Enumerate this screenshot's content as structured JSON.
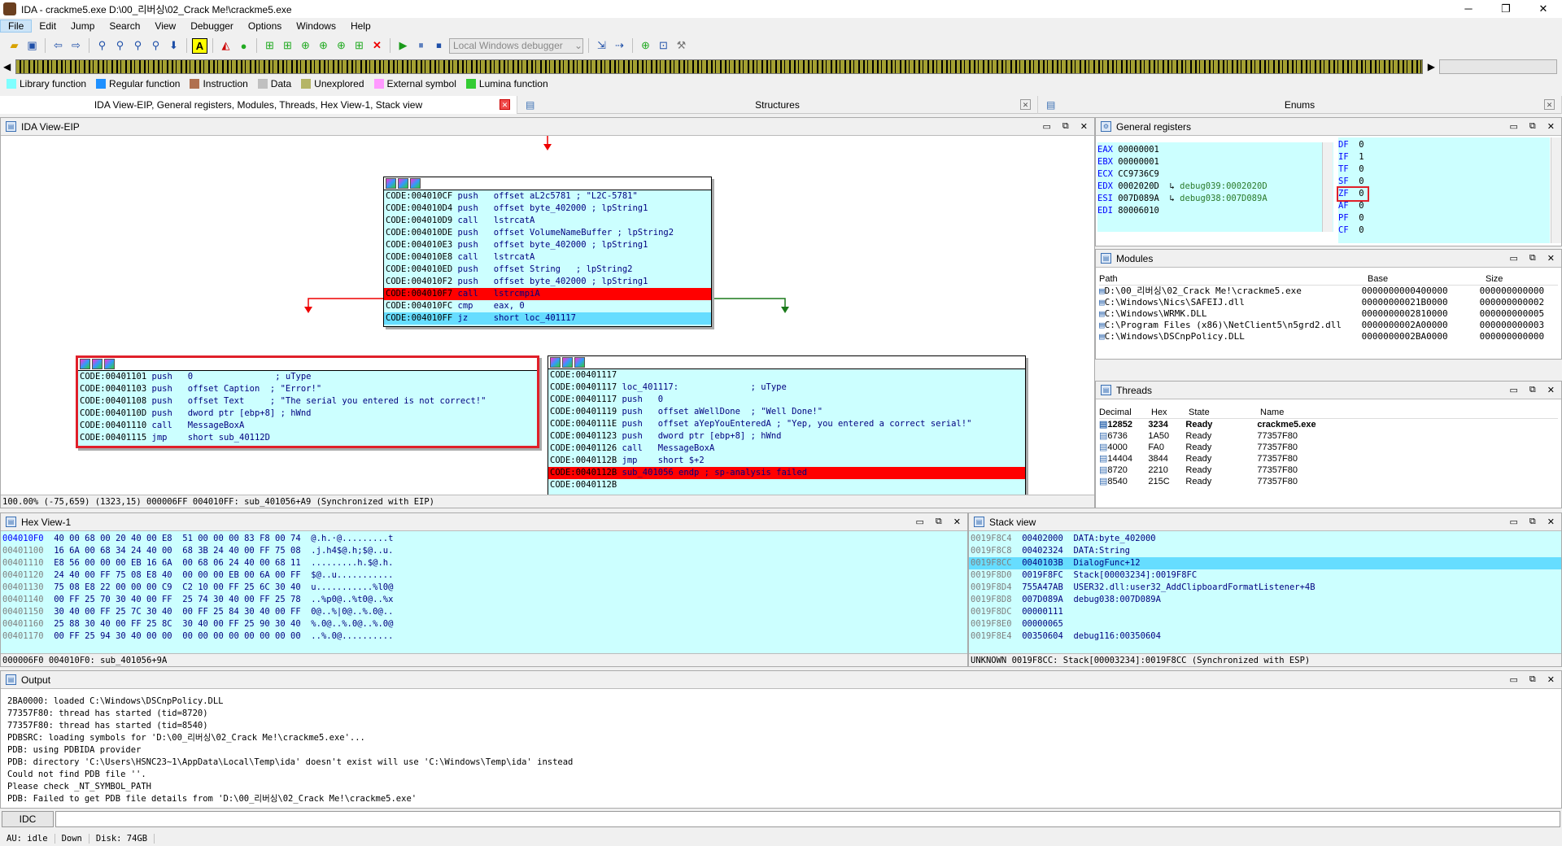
{
  "window": {
    "title": "IDA - crackme5.exe D:\\00_리버싱\\02_Crack Me!\\crackme5.exe",
    "minimize": "─",
    "maximize": "❐",
    "close": "✕"
  },
  "menu": [
    "File",
    "Edit",
    "Jump",
    "Search",
    "View",
    "Debugger",
    "Options",
    "Windows",
    "Help"
  ],
  "toolbar": {
    "debugger_select": "Local Windows debugger"
  },
  "legend": [
    {
      "label": "Library function",
      "color": "#7fffff"
    },
    {
      "label": "Regular function",
      "color": "#1e90ff"
    },
    {
      "label": "Instruction",
      "color": "#b07050"
    },
    {
      "label": "Data",
      "color": "#c0c0c0"
    },
    {
      "label": "Unexplored",
      "color": "#b5b566"
    },
    {
      "label": "External symbol",
      "color": "#ff99ff"
    },
    {
      "label": "Lumina function",
      "color": "#33cc33"
    }
  ],
  "tabs": [
    {
      "label": "IDA View-EIP, General registers, Modules, Threads, Hex View-1, Stack view"
    },
    {
      "label": "Structures"
    },
    {
      "label": "Enums"
    }
  ],
  "ida_view": {
    "title": "IDA View-EIP",
    "status": "100.00% (-75,659) (1323,15) 000006FF 004010FF: sub_401056+A9 (Synchronized with EIP)",
    "top_block": [
      {
        "a": "CODE:004010CF",
        "m": "push",
        "o": "offset aL2c5781 ; \"L2C-5781\"",
        "h": ""
      },
      {
        "a": "CODE:004010D4",
        "m": "push",
        "o": "offset byte_402000 ; lpString1",
        "h": ""
      },
      {
        "a": "CODE:004010D9",
        "m": "call",
        "o": "lstrcatA",
        "h": ""
      },
      {
        "a": "CODE:004010DE",
        "m": "push",
        "o": "offset VolumeNameBuffer ; lpString2",
        "h": ""
      },
      {
        "a": "CODE:004010E3",
        "m": "push",
        "o": "offset byte_402000 ; lpString1",
        "h": ""
      },
      {
        "a": "CODE:004010E8",
        "m": "call",
        "o": "lstrcatA",
        "h": ""
      },
      {
        "a": "CODE:004010ED",
        "m": "push",
        "o": "offset String   ; lpString2",
        "h": ""
      },
      {
        "a": "CODE:004010F2",
        "m": "push",
        "o": "offset byte_402000 ; lpString1",
        "h": ""
      },
      {
        "a": "CODE:004010F7",
        "m": "call",
        "o": "lstrcmpiA",
        "h": "red"
      },
      {
        "a": "CODE:004010FC",
        "m": "cmp",
        "o": "eax, 0",
        "h": ""
      },
      {
        "a": "CODE:004010FF",
        "m": "jz",
        "o": "short loc_401117",
        "h": "blue"
      }
    ],
    "left_block": [
      {
        "a": "CODE:00401101",
        "m": "push",
        "o": "0                ; uType"
      },
      {
        "a": "CODE:00401103",
        "m": "push",
        "o": "offset Caption  ; \"Error!\""
      },
      {
        "a": "CODE:00401108",
        "m": "push",
        "o": "offset Text     ; \"The serial you entered is not correct!\""
      },
      {
        "a": "CODE:0040110D",
        "m": "push",
        "o": "dword ptr [ebp+8] ; hWnd"
      },
      {
        "a": "CODE:00401110",
        "m": "call",
        "o": "MessageBoxA"
      },
      {
        "a": "CODE:00401115",
        "m": "jmp",
        "o": "short sub_40112D"
      }
    ],
    "right_block": [
      {
        "a": "CODE:00401117",
        "m": "",
        "o": "",
        "h": ""
      },
      {
        "a": "CODE:00401117",
        "m": "loc_401117:",
        "o": "              ; uType",
        "h": ""
      },
      {
        "a": "CODE:00401117",
        "m": "push",
        "o": "0",
        "h": ""
      },
      {
        "a": "CODE:00401119",
        "m": "push",
        "o": "offset aWellDone  ; \"Well Done!\"",
        "h": ""
      },
      {
        "a": "CODE:0040111E",
        "m": "push",
        "o": "offset aYepYouEnteredA ; \"Yep, you entered a correct serial!\"",
        "h": ""
      },
      {
        "a": "CODE:00401123",
        "m": "push",
        "o": "dword ptr [ebp+8] ; hWnd",
        "h": ""
      },
      {
        "a": "CODE:00401126",
        "m": "call",
        "o": "MessageBoxA",
        "h": ""
      },
      {
        "a": "CODE:0040112B",
        "m": "jmp",
        "o": "short $+2",
        "h": ""
      },
      {
        "a": "CODE:0040112B",
        "m": "sub_401056 endp ; sp-analysis failed",
        "o": "",
        "h": "red"
      },
      {
        "a": "CODE:0040112B",
        "m": "",
        "o": "",
        "h": ""
      }
    ]
  },
  "registers": {
    "title": "General registers",
    "regs": [
      {
        "n": "EAX",
        "v": "00000001",
        "d": ""
      },
      {
        "n": "EBX",
        "v": "00000001",
        "d": ""
      },
      {
        "n": "ECX",
        "v": "CC9736C9",
        "d": ""
      },
      {
        "n": "EDX",
        "v": "0002020D",
        "d": "debug039:0002020D"
      },
      {
        "n": "ESI",
        "v": "007D089A",
        "d": "debug038:007D089A"
      },
      {
        "n": "EDI",
        "v": "80006010",
        "d": ""
      }
    ],
    "flags": [
      {
        "n": "DF",
        "v": "0"
      },
      {
        "n": "IF",
        "v": "1"
      },
      {
        "n": "TF",
        "v": "0"
      },
      {
        "n": "SF",
        "v": "0"
      },
      {
        "n": "ZF",
        "v": "0"
      },
      {
        "n": "AF",
        "v": "0"
      },
      {
        "n": "PF",
        "v": "0"
      },
      {
        "n": "CF",
        "v": "0"
      }
    ]
  },
  "modules": {
    "title": "Modules",
    "cols": [
      "Path",
      "Base",
      "Size"
    ],
    "rows": [
      {
        "p": "D:\\00_리버싱\\02_Crack Me!\\crackme5.exe",
        "b": "0000000000400000",
        "s": "000000000000"
      },
      {
        "p": "C:\\Windows\\Nics\\SAFEIJ.dll",
        "b": "00000000021B0000",
        "s": "000000000002"
      },
      {
        "p": "C:\\Windows\\WRMK.DLL",
        "b": "0000000002810000",
        "s": "000000000005"
      },
      {
        "p": "C:\\Program Files (x86)\\NetClient5\\n5grd2.dll",
        "b": "0000000002A00000",
        "s": "000000000003"
      },
      {
        "p": "C:\\Windows\\DSCnpPolicy.DLL",
        "b": "0000000002BA0000",
        "s": "000000000000"
      }
    ]
  },
  "threads": {
    "title": "Threads",
    "cols": [
      "Decimal",
      "Hex",
      "State",
      "Name"
    ],
    "rows": [
      {
        "d": "12852",
        "h": "3234",
        "s": "Ready",
        "n": "crackme5.exe"
      },
      {
        "d": "6736",
        "h": "1A50",
        "s": "Ready",
        "n": "77357F80"
      },
      {
        "d": "4000",
        "h": "FA0",
        "s": "Ready",
        "n": "77357F80"
      },
      {
        "d": "14404",
        "h": "3844",
        "s": "Ready",
        "n": "77357F80"
      },
      {
        "d": "8720",
        "h": "2210",
        "s": "Ready",
        "n": "77357F80"
      },
      {
        "d": "8540",
        "h": "215C",
        "s": "Ready",
        "n": "77357F80"
      }
    ]
  },
  "hex": {
    "title": "Hex View-1",
    "status": "000006F0 004010F0: sub_401056+9A",
    "rows": [
      {
        "a": "004010F0",
        "b": "40 00 68 00 20 40 00 E8  51 00 00 00 83 F8 00 74",
        "t": "@.h.·@.........t"
      },
      {
        "a": "00401100",
        "b": "16 6A 00 68 34 24 40 00  68 3B 24 40 00 FF 75 08",
        "t": ".j.h4$@.h;$@..u."
      },
      {
        "a": "00401110",
        "b": "E8 56 00 00 00 EB 16 6A  00 68 06 24 40 00 68 11",
        "t": ".........h.$@.h."
      },
      {
        "a": "00401120",
        "b": "24 40 00 FF 75 08 E8 40  00 00 00 EB 00 6A 00 FF",
        "t": "$@..u..........."
      },
      {
        "a": "00401130",
        "b": "75 08 E8 22 00 00 00 C9  C2 10 00 FF 25 6C 30 40",
        "t": "u...........%l0@"
      },
      {
        "a": "00401140",
        "b": "00 FF 25 70 30 40 00 FF  25 74 30 40 00 FF 25 78",
        "t": "..%p0@..%t0@..%x"
      },
      {
        "a": "00401150",
        "b": "30 40 00 FF 25 7C 30 40  00 FF 25 84 30 40 00 FF",
        "t": "0@..%|0@..%.0@.."
      },
      {
        "a": "00401160",
        "b": "25 88 30 40 00 FF 25 8C  30 40 00 FF 25 90 30 40",
        "t": "%.0@..%.0@..%.0@"
      },
      {
        "a": "00401170",
        "b": "00 FF 25 94 30 40 00 00  00 00 00 00 00 00 00 00",
        "t": "..%.0@.........."
      }
    ]
  },
  "stack": {
    "title": "Stack view",
    "status": "UNKNOWN 0019F8CC: Stack[00003234]:0019F8CC (Synchronized with ESP)",
    "rows": [
      {
        "a": "0019F8C4",
        "v": "00402000",
        "d": "DATA:byte_402000",
        "h": false
      },
      {
        "a": "0019F8C8",
        "v": "00402324",
        "d": "DATA:String",
        "h": false
      },
      {
        "a": "0019F8CC",
        "v": "0040103B",
        "d": "DialogFunc+12",
        "h": true
      },
      {
        "a": "0019F8D0",
        "v": "0019F8FC",
        "d": "Stack[00003234]:0019F8FC",
        "h": false
      },
      {
        "a": "0019F8D4",
        "v": "755A47AB",
        "d": "USER32.dll:user32_AddClipboardFormatListener+4B",
        "h": false
      },
      {
        "a": "0019F8D8",
        "v": "007D089A",
        "d": "debug038:007D089A",
        "h": false
      },
      {
        "a": "0019F8DC",
        "v": "00000111",
        "d": "",
        "h": false
      },
      {
        "a": "0019F8E0",
        "v": "00000065",
        "d": "",
        "h": false
      },
      {
        "a": "0019F8E4",
        "v": "00350604",
        "d": "debug116:00350604",
        "h": false
      }
    ]
  },
  "output": {
    "title": "Output",
    "lines": [
      "2BA0000: loaded C:\\Windows\\DSCnpPolicy.DLL",
      "77357F80: thread has started (tid=8720)",
      "77357F80: thread has started (tid=8540)",
      "PDBSRC: loading symbols for 'D:\\00_리버싱\\02_Crack Me!\\crackme5.exe'...",
      "PDB: using PDBIDA provider",
      "PDB: directory 'C:\\Users\\HSNC23~1\\AppData\\Local\\Temp\\ida' doesn't exist will use 'C:\\Windows\\Temp\\ida' instead",
      "Could not find PDB file ''.",
      "Please check _NT_SYMBOL_PATH",
      "PDB: Failed to get PDB file details from 'D:\\00_리버싱\\02_Crack Me!\\crackme5.exe'"
    ]
  },
  "idc": {
    "label": "IDC"
  },
  "statusbar": {
    "au": "AU:  idle",
    "dir": "Down",
    "disk": "Disk: 74GB"
  }
}
